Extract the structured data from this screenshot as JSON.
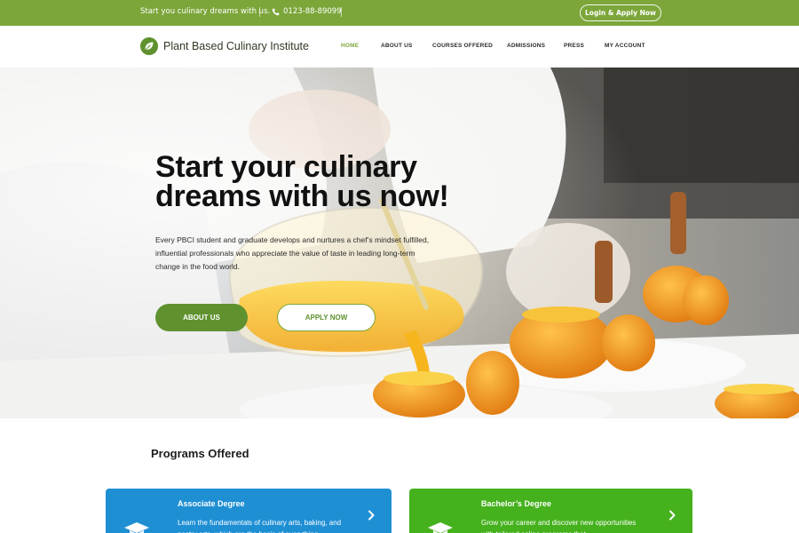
{
  "topbar": {
    "tagline": "Start you culinary dreams with us.",
    "phone": "0123-88-89099",
    "login_label": "Login & Apply Now"
  },
  "brand": {
    "name": "Plant Based Culinary Institute"
  },
  "nav": {
    "items": [
      "HOME",
      "ABOUT US",
      "COURSES OFFERED",
      "ADMISSIONS",
      "PRESS",
      "MY ACCOUNT"
    ],
    "active": "HOME"
  },
  "hero": {
    "heading": "Start your culinary dreams with us now!",
    "body": "Every PBCI student and graduate develops and nurtures a chef’s mindset fulfilled, influential professionals who appreciate the value of taste in leading long-term change in the food world.",
    "about_label": "ABOUT US",
    "apply_label": "APPLY NOW"
  },
  "programs": {
    "title": "Programs Offered",
    "cards": [
      {
        "title": "Associate Degree",
        "desc": "Learn the fundamentals of culinary arts, baking, and pastry arts, which are the basis of everything",
        "color": "#1f8fd4"
      },
      {
        "title": "Bachelor’s Degree",
        "desc": "Grow your career and discover new opportunities with tailored online programs that",
        "color": "#45b11d"
      }
    ]
  },
  "colors": {
    "accent": "#7ca63a",
    "accent_dark": "#5f922e"
  },
  "icons": [
    "phone-icon",
    "leaf-logo-icon",
    "graduation-cap-icon",
    "chevron-right-icon"
  ]
}
